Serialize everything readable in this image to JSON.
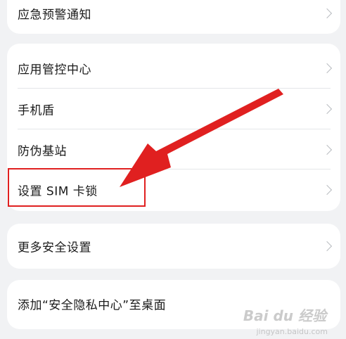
{
  "settings": {
    "card1": {
      "items": [
        {
          "label": "应急预警通知"
        }
      ]
    },
    "card2": {
      "items": [
        {
          "label": "应用管控中心"
        },
        {
          "label": "手机盾"
        },
        {
          "label": "防伪基站"
        },
        {
          "label": "设置 SIM 卡锁"
        }
      ]
    },
    "card3": {
      "items": [
        {
          "label": "更多安全设置"
        }
      ]
    },
    "card4": {
      "items": [
        {
          "label": "添加“安全隐私中心”至桌面"
        }
      ]
    }
  },
  "annotation": {
    "arrow_color": "#e02020",
    "highlight_color": "#e02020"
  },
  "watermark": {
    "logo_text": "Bai du 经验",
    "sub_text": "jingyan.baidu.com"
  }
}
